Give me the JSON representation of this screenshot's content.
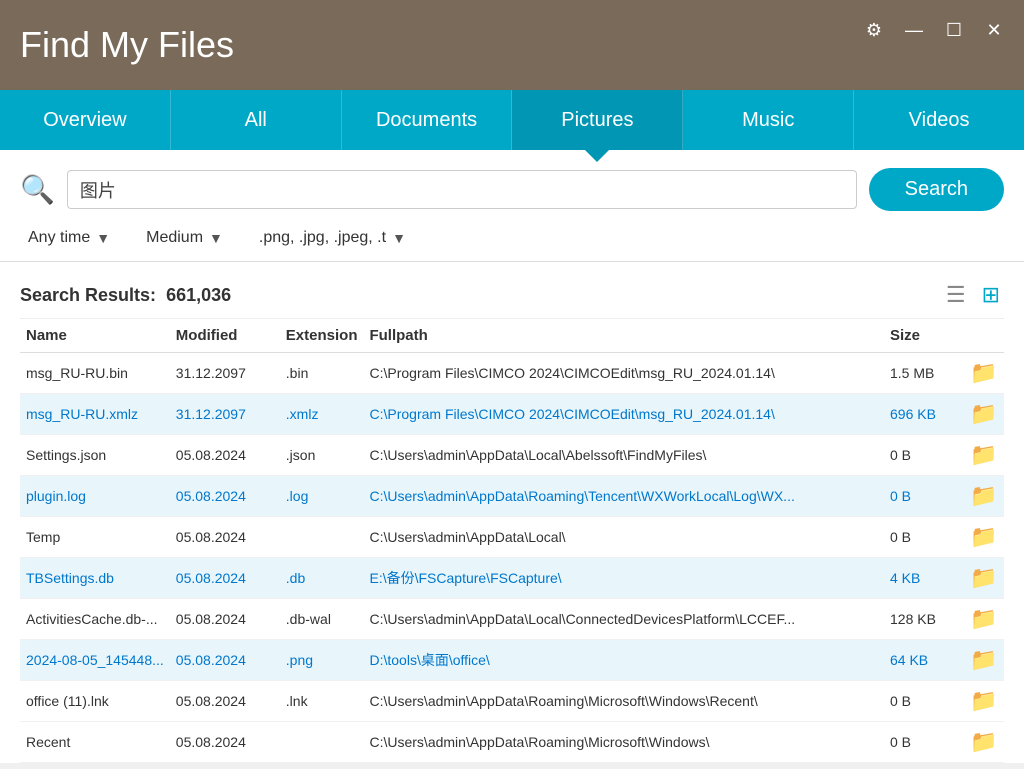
{
  "app": {
    "title": "Find My Files"
  },
  "title_controls": {
    "settings": "⚙",
    "minimize": "—",
    "maximize": "☐",
    "close": "✕"
  },
  "tabs": [
    {
      "id": "overview",
      "label": "Overview",
      "active": false
    },
    {
      "id": "all",
      "label": "All",
      "active": false
    },
    {
      "id": "documents",
      "label": "Documents",
      "active": false
    },
    {
      "id": "pictures",
      "label": "Pictures",
      "active": true
    },
    {
      "id": "music",
      "label": "Music",
      "active": false
    },
    {
      "id": "videos",
      "label": "Videos",
      "active": false
    }
  ],
  "search": {
    "placeholder": "图片",
    "value": "图片",
    "button_label": "Search"
  },
  "filters": {
    "time": {
      "label": "Any time",
      "arrow": "▼"
    },
    "size": {
      "label": "Medium",
      "arrow": "▼"
    },
    "type": {
      "label": ".png, .jpg, .jpeg, .t",
      "arrow": "▼"
    }
  },
  "results": {
    "label": "Search Results:",
    "count": "661,036"
  },
  "table": {
    "columns": [
      "Name",
      "Modified",
      "Extension",
      "Fullpath",
      "Size",
      ""
    ],
    "rows": [
      {
        "name": "msg_RU-RU.bin",
        "modified": "31.12.2097",
        "ext": ".bin",
        "path": "C:\\Program Files\\CIMCO 2024\\CIMCOEdit\\msg_RU_2024.01.14\\",
        "size": "1.5 MB",
        "highlighted": false
      },
      {
        "name": "msg_RU-RU.xmlz",
        "modified": "31.12.2097",
        "ext": ".xmlz",
        "path": "C:\\Program Files\\CIMCO 2024\\CIMCOEdit\\msg_RU_2024.01.14\\",
        "size": "696 KB",
        "highlighted": true
      },
      {
        "name": "Settings.json",
        "modified": "05.08.2024",
        "ext": ".json",
        "path": "C:\\Users\\admin\\AppData\\Local\\Abelssoft\\FindMyFiles\\",
        "size": "0 B",
        "highlighted": false
      },
      {
        "name": "plugin.log",
        "modified": "05.08.2024",
        "ext": ".log",
        "path": "C:\\Users\\admin\\AppData\\Roaming\\Tencent\\WXWorkLocal\\Log\\WX...",
        "size": "0 B",
        "highlighted": true
      },
      {
        "name": "Temp",
        "modified": "05.08.2024",
        "ext": "",
        "path": "C:\\Users\\admin\\AppData\\Local\\",
        "size": "0 B",
        "highlighted": false
      },
      {
        "name": "TBSettings.db",
        "modified": "05.08.2024",
        "ext": ".db",
        "path": "E:\\备份\\FSCapture\\FSCapture\\",
        "size": "4 KB",
        "highlighted": true
      },
      {
        "name": "ActivitiesCache.db-...",
        "modified": "05.08.2024",
        "ext": ".db-wal",
        "path": "C:\\Users\\admin\\AppData\\Local\\ConnectedDevicesPlatform\\LCCEF...",
        "size": "128 KB",
        "highlighted": false
      },
      {
        "name": "2024-08-05_145448...",
        "modified": "05.08.2024",
        "ext": ".png",
        "path": "D:\\tools\\桌面\\office\\",
        "size": "64 KB",
        "highlighted": true
      },
      {
        "name": "office (11).lnk",
        "modified": "05.08.2024",
        "ext": ".lnk",
        "path": "C:\\Users\\admin\\AppData\\Roaming\\Microsoft\\Windows\\Recent\\",
        "size": "0 B",
        "highlighted": false
      },
      {
        "name": "Recent",
        "modified": "05.08.2024",
        "ext": "",
        "path": "C:\\Users\\admin\\AppData\\Roaming\\Microsoft\\Windows\\",
        "size": "0 B",
        "highlighted": false
      }
    ]
  }
}
